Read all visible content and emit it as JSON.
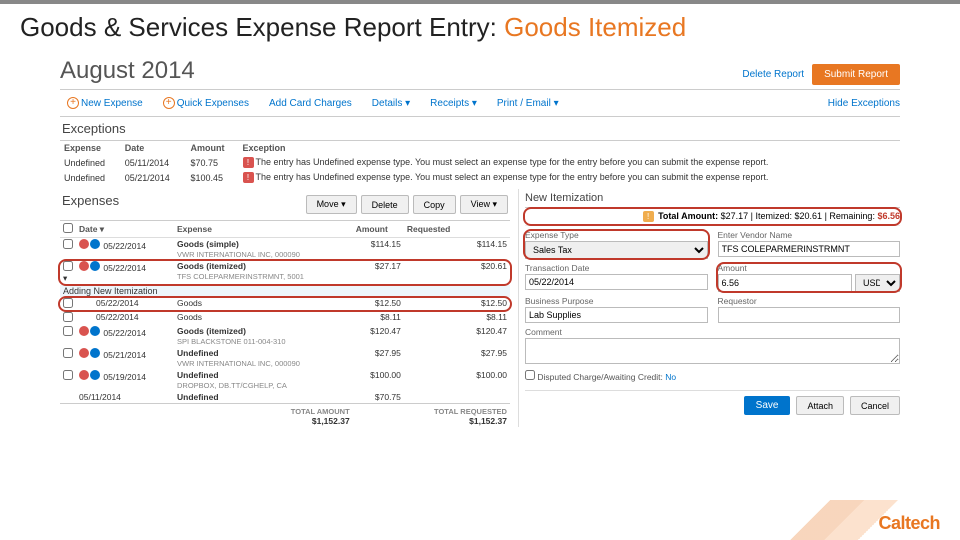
{
  "slide": {
    "title_before": "Goods & Services Expense Report Entry: ",
    "title_em": "Goods Itemized"
  },
  "header": {
    "title": "August 2014",
    "delete": "Delete Report",
    "submit": "Submit Report"
  },
  "toolbar": {
    "new_expense": "New Expense",
    "quick_expenses": "Quick Expenses",
    "add_card": "Add Card Charges",
    "details": "Details ▾",
    "receipts": "Receipts ▾",
    "print": "Print / Email ▾",
    "hide_exc": "Hide Exceptions"
  },
  "exceptions": {
    "title": "Exceptions",
    "cols": {
      "expense": "Expense",
      "date": "Date",
      "amount": "Amount",
      "exception": "Exception"
    },
    "rows": [
      {
        "expense": "Undefined",
        "date": "05/11/2014",
        "amount": "$70.75",
        "msg": "The entry has Undefined expense type. You must select an expense type for the entry before you can submit the expense report."
      },
      {
        "expense": "Undefined",
        "date": "05/21/2014",
        "amount": "$100.45",
        "msg": "The entry has Undefined expense type. You must select an expense type for the entry before you can submit the expense report."
      }
    ]
  },
  "expenses": {
    "title": "Expenses",
    "btns": {
      "move": "Move ▾",
      "delete": "Delete",
      "copy": "Copy",
      "view": "View ▾"
    },
    "cols": {
      "date": "Date ▾",
      "expense": "Expense",
      "amount": "Amount",
      "requested": "Requested"
    },
    "adding": "Adding New Itemization",
    "total_label": "TOTAL AMOUNT",
    "total_req_label": "TOTAL REQUESTED",
    "total": "$1,152.37",
    "total_req": "$1,152.37",
    "rows": [
      {
        "cb": true,
        "date": "05/22/2014",
        "name": "Goods (simple)",
        "sub": "VWR INTERNATIONAL INC, 000090",
        "amount": "$114.15",
        "req": "$114.15",
        "icons": [
          "red",
          "blue"
        ]
      },
      {
        "cb": true,
        "date": "05/22/2014",
        "name": "Goods (itemized)",
        "sub": "TFS COLEPARMERINSTRMNT, 5001",
        "amount": "$27.17",
        "req": "$20.61",
        "icons": [
          "red",
          "blue"
        ],
        "ring": true,
        "chev": true
      }
    ],
    "sub_rows": [
      {
        "date": "05/22/2014",
        "name": "Goods",
        "amount": "$12.50",
        "req": "$12.50"
      },
      {
        "date": "05/22/2014",
        "name": "Goods",
        "amount": "$8.11",
        "req": "$8.11"
      }
    ],
    "rows2": [
      {
        "cb": true,
        "date": "05/22/2014",
        "name": "Goods (itemized)",
        "sub": "SPI BLACKSTONE 011-004-310",
        "amount": "$120.47",
        "req": "$120.47",
        "icons": [
          "red",
          "blue"
        ]
      },
      {
        "cb": true,
        "date": "05/21/2014",
        "name": "Undefined",
        "sub": "VWR INTERNATIONAL INC, 000090",
        "amount": "$27.95",
        "req": "$27.95",
        "icons": [
          "red",
          "blue"
        ]
      },
      {
        "cb": true,
        "date": "05/19/2014",
        "name": "Undefined",
        "sub": "DROPBOX, DB.TT/CGHELP, CA",
        "amount": "$100.00",
        "req": "$100.00",
        "icons": [
          "red",
          "blue"
        ]
      },
      {
        "cb": false,
        "date": "05/11/2014",
        "name": "Undefined",
        "sub": "",
        "amount": "$70.75",
        "req": "",
        "icons": []
      }
    ]
  },
  "right": {
    "title": "New Itemization",
    "summary": {
      "total_lbl": "Total Amount:",
      "total": "$27.17",
      "item_lbl": "| Itemized:",
      "item": "$20.61",
      "rem_lbl": "| Remaining:",
      "rem": "$6.56"
    },
    "form": {
      "expense_type_lbl": "Expense Type",
      "expense_type_val": "Sales Tax",
      "vendor_lbl": "Enter Vendor Name",
      "vendor_val": "TFS COLEPARMERINSTRMNT",
      "date_lbl": "Transaction Date",
      "date_val": "05/22/2014",
      "amount_lbl": "Amount",
      "amount_val": "6.56",
      "curr": "USD",
      "purpose_lbl": "Business Purpose",
      "purpose_val": "Lab Supplies",
      "requestor_lbl": "Requestor",
      "comment_lbl": "Comment"
    },
    "disputed": "Disputed Charge/Awaiting Credit:",
    "disputed_val": "No",
    "save": "Save",
    "attach": "Attach",
    "cancel": "Cancel"
  },
  "brand": "Caltech"
}
